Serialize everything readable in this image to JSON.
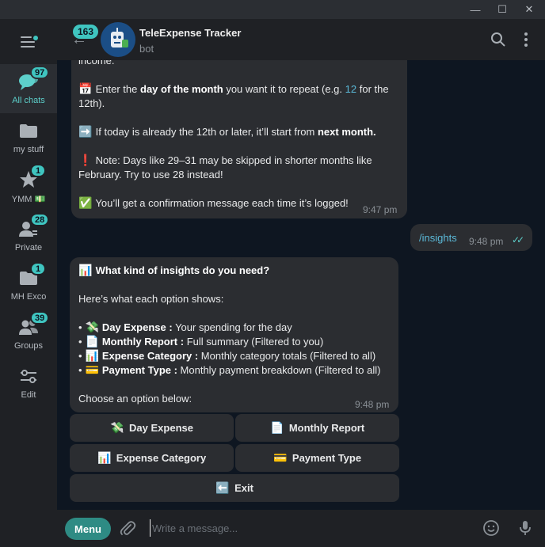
{
  "window": {
    "minimize": "—",
    "maximize": "☐",
    "close": "✕"
  },
  "sidebar": {
    "items": [
      {
        "label": "All chats",
        "badge": "97",
        "icon": "chat-bubbles-icon"
      },
      {
        "label": "my stuff",
        "badge": "",
        "icon": "folder-icon"
      },
      {
        "label": "YMM 💵",
        "badge": "1",
        "icon": "star-icon"
      },
      {
        "label": "Private",
        "badge": "28",
        "icon": "person-icon"
      },
      {
        "label": "MH Exco",
        "badge": "1",
        "icon": "folder-icon"
      },
      {
        "label": "Groups",
        "badge": "39",
        "icon": "group-icon"
      },
      {
        "label": "Edit",
        "badge": "",
        "icon": "edit-sliders-icon"
      }
    ]
  },
  "header": {
    "unread_count": "163",
    "title": "TeleExpense Tracker",
    "subtitle": "bot"
  },
  "messages": {
    "m1": {
      "line0": "income.",
      "line1_pre": "Enter the ",
      "line1_bold": "day of the month",
      "line1_post": " you want it to repeat (e.g. ",
      "line1_num": "12",
      "line1_end": " for the",
      "line2": "12th).",
      "line3_pre": "If today is already the 12th or later, it’ll start from ",
      "line3_bold": "next month.",
      "line4": "Note: Days like 29–31 may be skipped in shorter months like",
      "line5": "February. Try to use 28 instead!",
      "line6": "You’ll get a confirmation message each time it’s logged!",
      "time": "9:47 pm",
      "emoji_calendar": "📅",
      "emoji_arrow": "➡️",
      "emoji_exclaim": "❗",
      "emoji_check": "✅"
    },
    "m2": {
      "text": "/insights",
      "time": "9:48 pm",
      "ticks": "✓✓"
    },
    "m3": {
      "title": "What kind of insights do you need?",
      "intro": "Here’s what each option shows:",
      "options": [
        {
          "bullet": "•",
          "emoji": "💸",
          "name": "Day Expense :",
          "desc": " Your spending for the day"
        },
        {
          "bullet": "•",
          "emoji": "📄",
          "name": "Monthly Report :",
          "desc": " Full summary (Filtered to you)"
        },
        {
          "bullet": "•",
          "emoji": "📊",
          "name": "Expense Category :",
          "desc": " Monthly category totals (Filtered to all)"
        },
        {
          "bullet": "•",
          "emoji": "💳",
          "name": "Payment Type :",
          "desc": " Monthly payment breakdown (Filtered to all)"
        }
      ],
      "outro": "Choose an option below:",
      "time": "9:48 pm",
      "emoji_title": "📊"
    }
  },
  "keyboard": {
    "day_expense": {
      "emoji": "💸",
      "label": "Day Expense"
    },
    "monthly_report": {
      "emoji": "📄",
      "label": "Monthly Report"
    },
    "expense_category": {
      "emoji": "📊",
      "label": "Expense Category"
    },
    "payment_type": {
      "emoji": "💳",
      "label": "Payment Type"
    },
    "exit": {
      "emoji": "⬅️",
      "label": "Exit"
    }
  },
  "composer": {
    "menu_label": "Menu",
    "placeholder": "Write a message..."
  },
  "colors": {
    "accent": "#3fc5c0",
    "background": "#0e1621",
    "bubble": "#2b2d31",
    "panel": "#1f2125",
    "menu_button": "#2e8b84"
  }
}
